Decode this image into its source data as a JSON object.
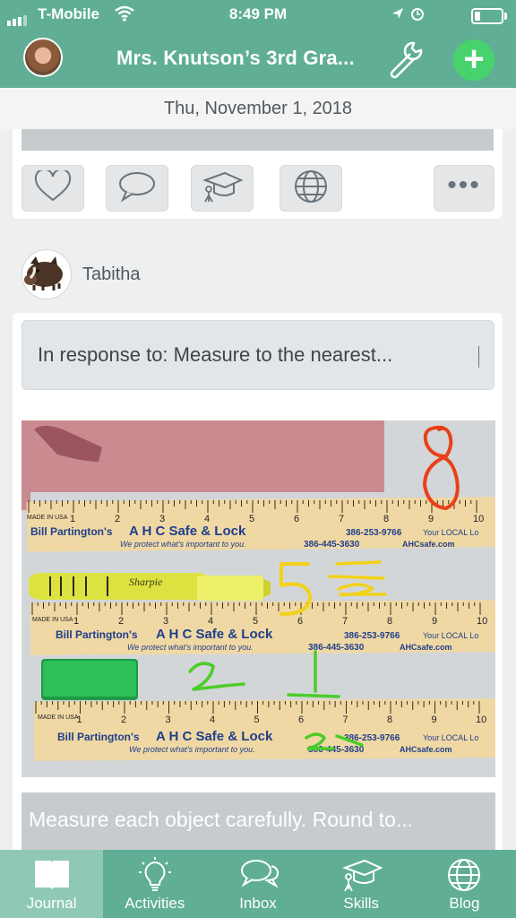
{
  "status_bar": {
    "carrier": "T-Mobile",
    "time": "8:49 PM",
    "battery_level": 0.2
  },
  "header": {
    "title": "Mrs. Knutson’s 3rd Gra...",
    "wrench_icon": "wrench-icon",
    "add_icon": "plus-icon"
  },
  "date": "Thu, November 1, 2018",
  "post_actions": {
    "icons": [
      "heart-icon",
      "comment-icon",
      "skills-icon",
      "globe-icon",
      "more-icon"
    ],
    "more_label": "•••"
  },
  "author": {
    "name": "Tabitha",
    "avatar_icon": "boar-icon"
  },
  "post": {
    "response": "In response to: Measure to the nearest...",
    "photo": {
      "brand": "Bill Partington's",
      "company": "A H C Safe & Lock",
      "phone1": "386-253-9766",
      "local": "Your LOCAL Lo",
      "tagline": "We protect what's important to you.",
      "phone2": "386-445-3630",
      "site": "AHCsafe.com",
      "marker_brand": "Sharpie",
      "made_in": "MADE IN USA",
      "ruler_numbers": [
        "1",
        "2",
        "3",
        "4",
        "5",
        "6",
        "7",
        "8",
        "9",
        "10"
      ],
      "answers": [
        "8",
        "5",
        "1",
        "2",
        "2",
        "1",
        "2"
      ]
    },
    "caption": "Measure each object carefully. Round to..."
  },
  "tabs": [
    {
      "label": "Journal",
      "icon": "journal-icon",
      "active": true
    },
    {
      "label": "Activities",
      "icon": "lightbulb-icon",
      "active": false
    },
    {
      "label": "Inbox",
      "icon": "chat-bubbles-icon",
      "active": false
    },
    {
      "label": "Skills",
      "icon": "skills-icon",
      "active": false
    },
    {
      "label": "Blog",
      "icon": "globe-icon",
      "active": false
    }
  ],
  "colors": {
    "header": "#5fae95",
    "active_tab": "#8fc9b6",
    "add_button": "#47d26e",
    "ink_red": "#e8401a",
    "ink_yellow": "#f2d21a",
    "ink_green": "#4ccc2a"
  }
}
